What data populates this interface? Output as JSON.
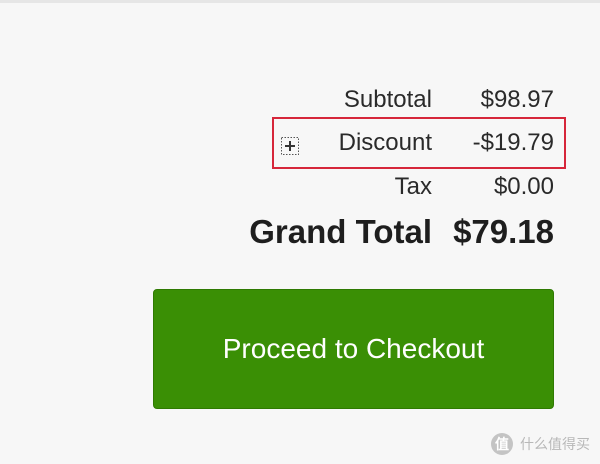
{
  "summary": {
    "subtotal_label": "Subtotal",
    "subtotal_value": "$98.97",
    "discount_label": "Discount",
    "discount_value": "-$19.79",
    "tax_label": "Tax",
    "tax_value": "$0.00",
    "grand_total_label": "Grand Total",
    "grand_total_value": "$79.18"
  },
  "checkout": {
    "button_label": "Proceed to Checkout"
  },
  "watermark": {
    "text": "什么值得买",
    "icon": "smzdm-logo-icon"
  },
  "colors": {
    "button_green": "#3a8f05",
    "highlight_red": "#d6263a",
    "background": "#f7f7f7"
  }
}
